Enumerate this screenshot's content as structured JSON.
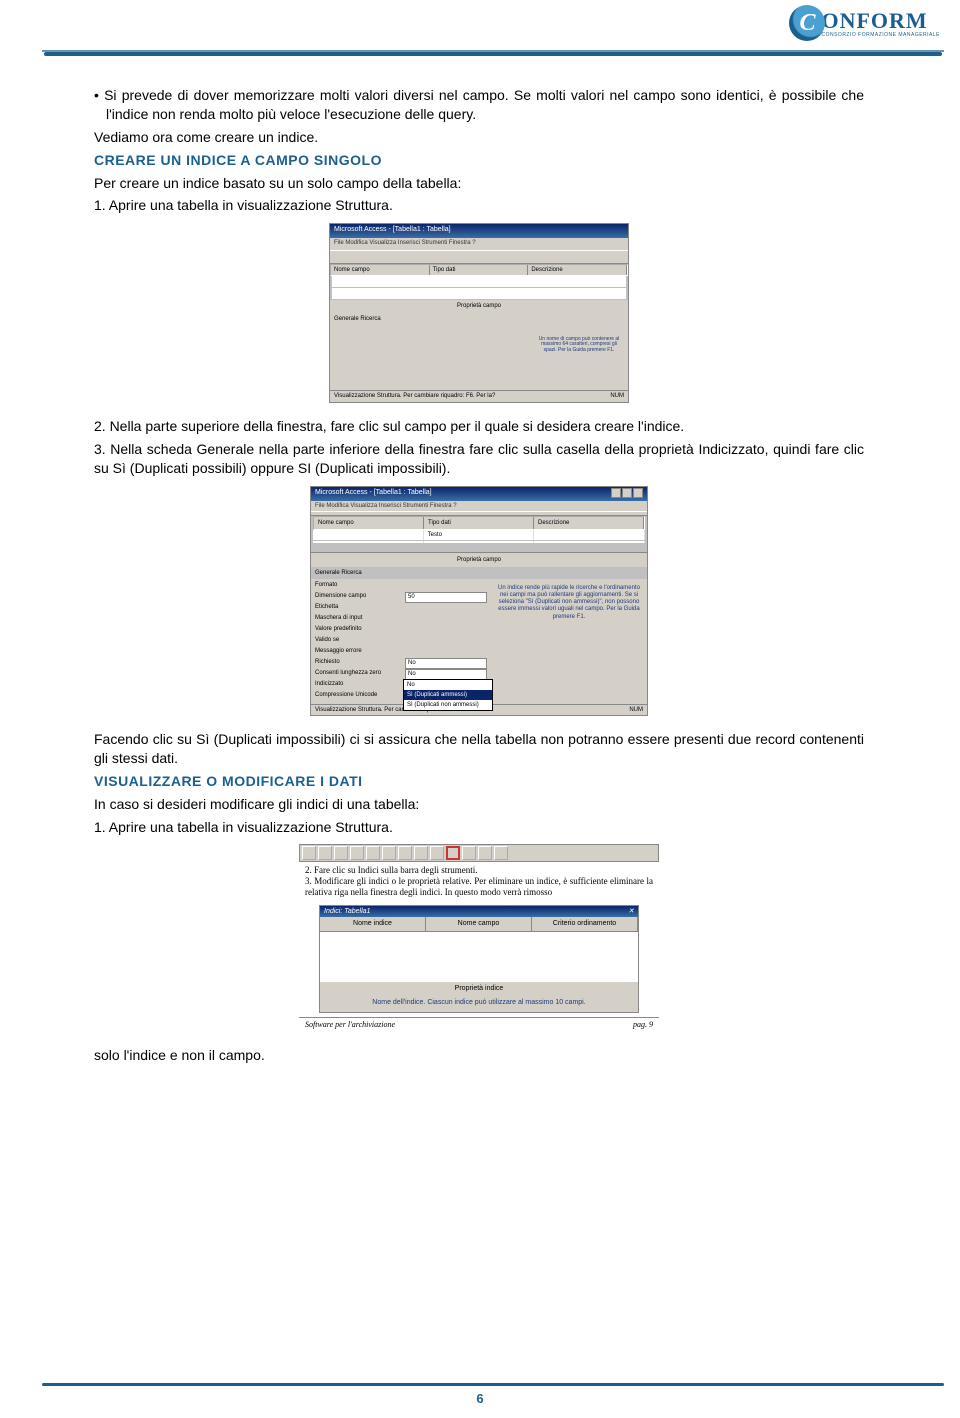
{
  "header": {
    "logo_letter": "C",
    "logo_text": "ONFORM",
    "logo_sub": "CONSORZIO FORMAZIONE MANAGERIALE"
  },
  "body": {
    "bullet1": "Si prevede di dover memorizzare molti valori diversi nel campo. Se molti valori nel campo sono identici, è possibile che l'indice non renda molto più veloce l'esecuzione delle query.",
    "para1": "Vediamo ora come creare un indice.",
    "h1": "CREARE UN INDICE A CAMPO SINGOLO",
    "para2": "Per creare un indice basato su un solo campo della tabella:",
    "step1": "1. Aprire una tabella in visualizzazione Struttura.",
    "step2": "2. Nella parte superiore della finestra, fare clic sul campo per il quale si desidera creare l'indice.",
    "step3": "3. Nella scheda Generale nella parte inferiore della finestra fare clic sulla casella della proprietà Indicizzato, quindi fare clic su Sì (Duplicati possibili) oppure SI (Duplicati impossibili).",
    "para3": "Facendo clic su Sì (Duplicati impossibili) ci si assicura che nella tabella non potranno essere presenti due record contenenti gli stessi dati.",
    "h2": "VISUALIZZARE O MODIFICARE I DATI",
    "para4": "In caso si desideri modificare gli indici di una tabella:",
    "step4": "1. Aprire una tabella in visualizzazione Struttura.",
    "para5": "solo l'indice e non il campo."
  },
  "screenshot1": {
    "title": "Microsoft Access - [Tabella1 : Tabella]",
    "menu": "File  Modifica  Visualizza  Inserisci  Strumenti  Finestra  ?",
    "cols": {
      "c1": "Nome campo",
      "c2": "Tipo dati",
      "c3": "Descrizione"
    },
    "midlabel": "Proprietà campo",
    "tabs": "Generale   Ricerca",
    "hint": "Un nome di campo può contenere al massimo 64 caratteri, compresi gli spazi. Per la Guida premere F1.",
    "status_l": "Visualizzazione Struttura. Per cambiare riquadro: F6. Per la?",
    "status_r": "NUM"
  },
  "screenshot2": {
    "title": "Microsoft Access - [Tabella1 : Tabella]",
    "menu": "File  Modifica  Visualizza  Inserisci  Strumenti  Finestra  ?",
    "cols": {
      "c1": "Nome campo",
      "c2": "Tipo dati",
      "c3": "Descrizione"
    },
    "row1_c2": "Testo",
    "midlabel": "Proprietà campo",
    "tabs": "Generale   Ricerca",
    "props": {
      "p1": "Formato",
      "p2": "Dimensione campo",
      "v2": "50",
      "p3": "Etichetta",
      "p4": "Maschera di input",
      "p5": "Valore predefinito",
      "p6": "Valido se",
      "p7": "Messaggio errore",
      "p8": "Richiesto",
      "v8": "No",
      "p9": "Consenti lunghezza zero",
      "v9": "No",
      "p10": "Indicizzato",
      "v10": "Sì (Duplicati ammessi)",
      "p11": "Compressione Unicode",
      "v11": "No"
    },
    "dropdown": {
      "o1": "No",
      "o2": "Sì (Duplicati ammessi)",
      "o3": "Sì (Duplicati non ammessi)"
    },
    "hint": "Un indice rende più rapide le ricerche e l'ordinamento nei campi ma può rallentare gli aggiornamenti. Se si seleziona \"Sì (Duplicati non ammessi)\", non possono essere immessi valori uguali nel campo. Per la Guida premere F1.",
    "status_l": "Visualizzazione Struttura. Per cambiare riquadro: F6. Per la G",
    "status_r": "NUM"
  },
  "screenshot3": {
    "step2": "2. Fare clic su Indici sulla barra degli strumenti.",
    "step3": "3. Modificare gli indici o le proprietà relative. Per eliminare un indice, è sufficiente eliminare la relativa riga nella finestra degli indici. In questo modo verrà rimosso",
    "wtitle": "Indici: Tabella1",
    "cols": {
      "c1": "Nome indice",
      "c2": "Nome campo",
      "c3": "Criterio ordinamento"
    },
    "midlabel": "Proprietà indice",
    "hint": "Nome dell'indice. Ciascun indice può utilizzare al massimo 10 campi.",
    "foot_l": "Software per l'archiviazione",
    "foot_r": "pag. 9"
  },
  "page_number": "6"
}
